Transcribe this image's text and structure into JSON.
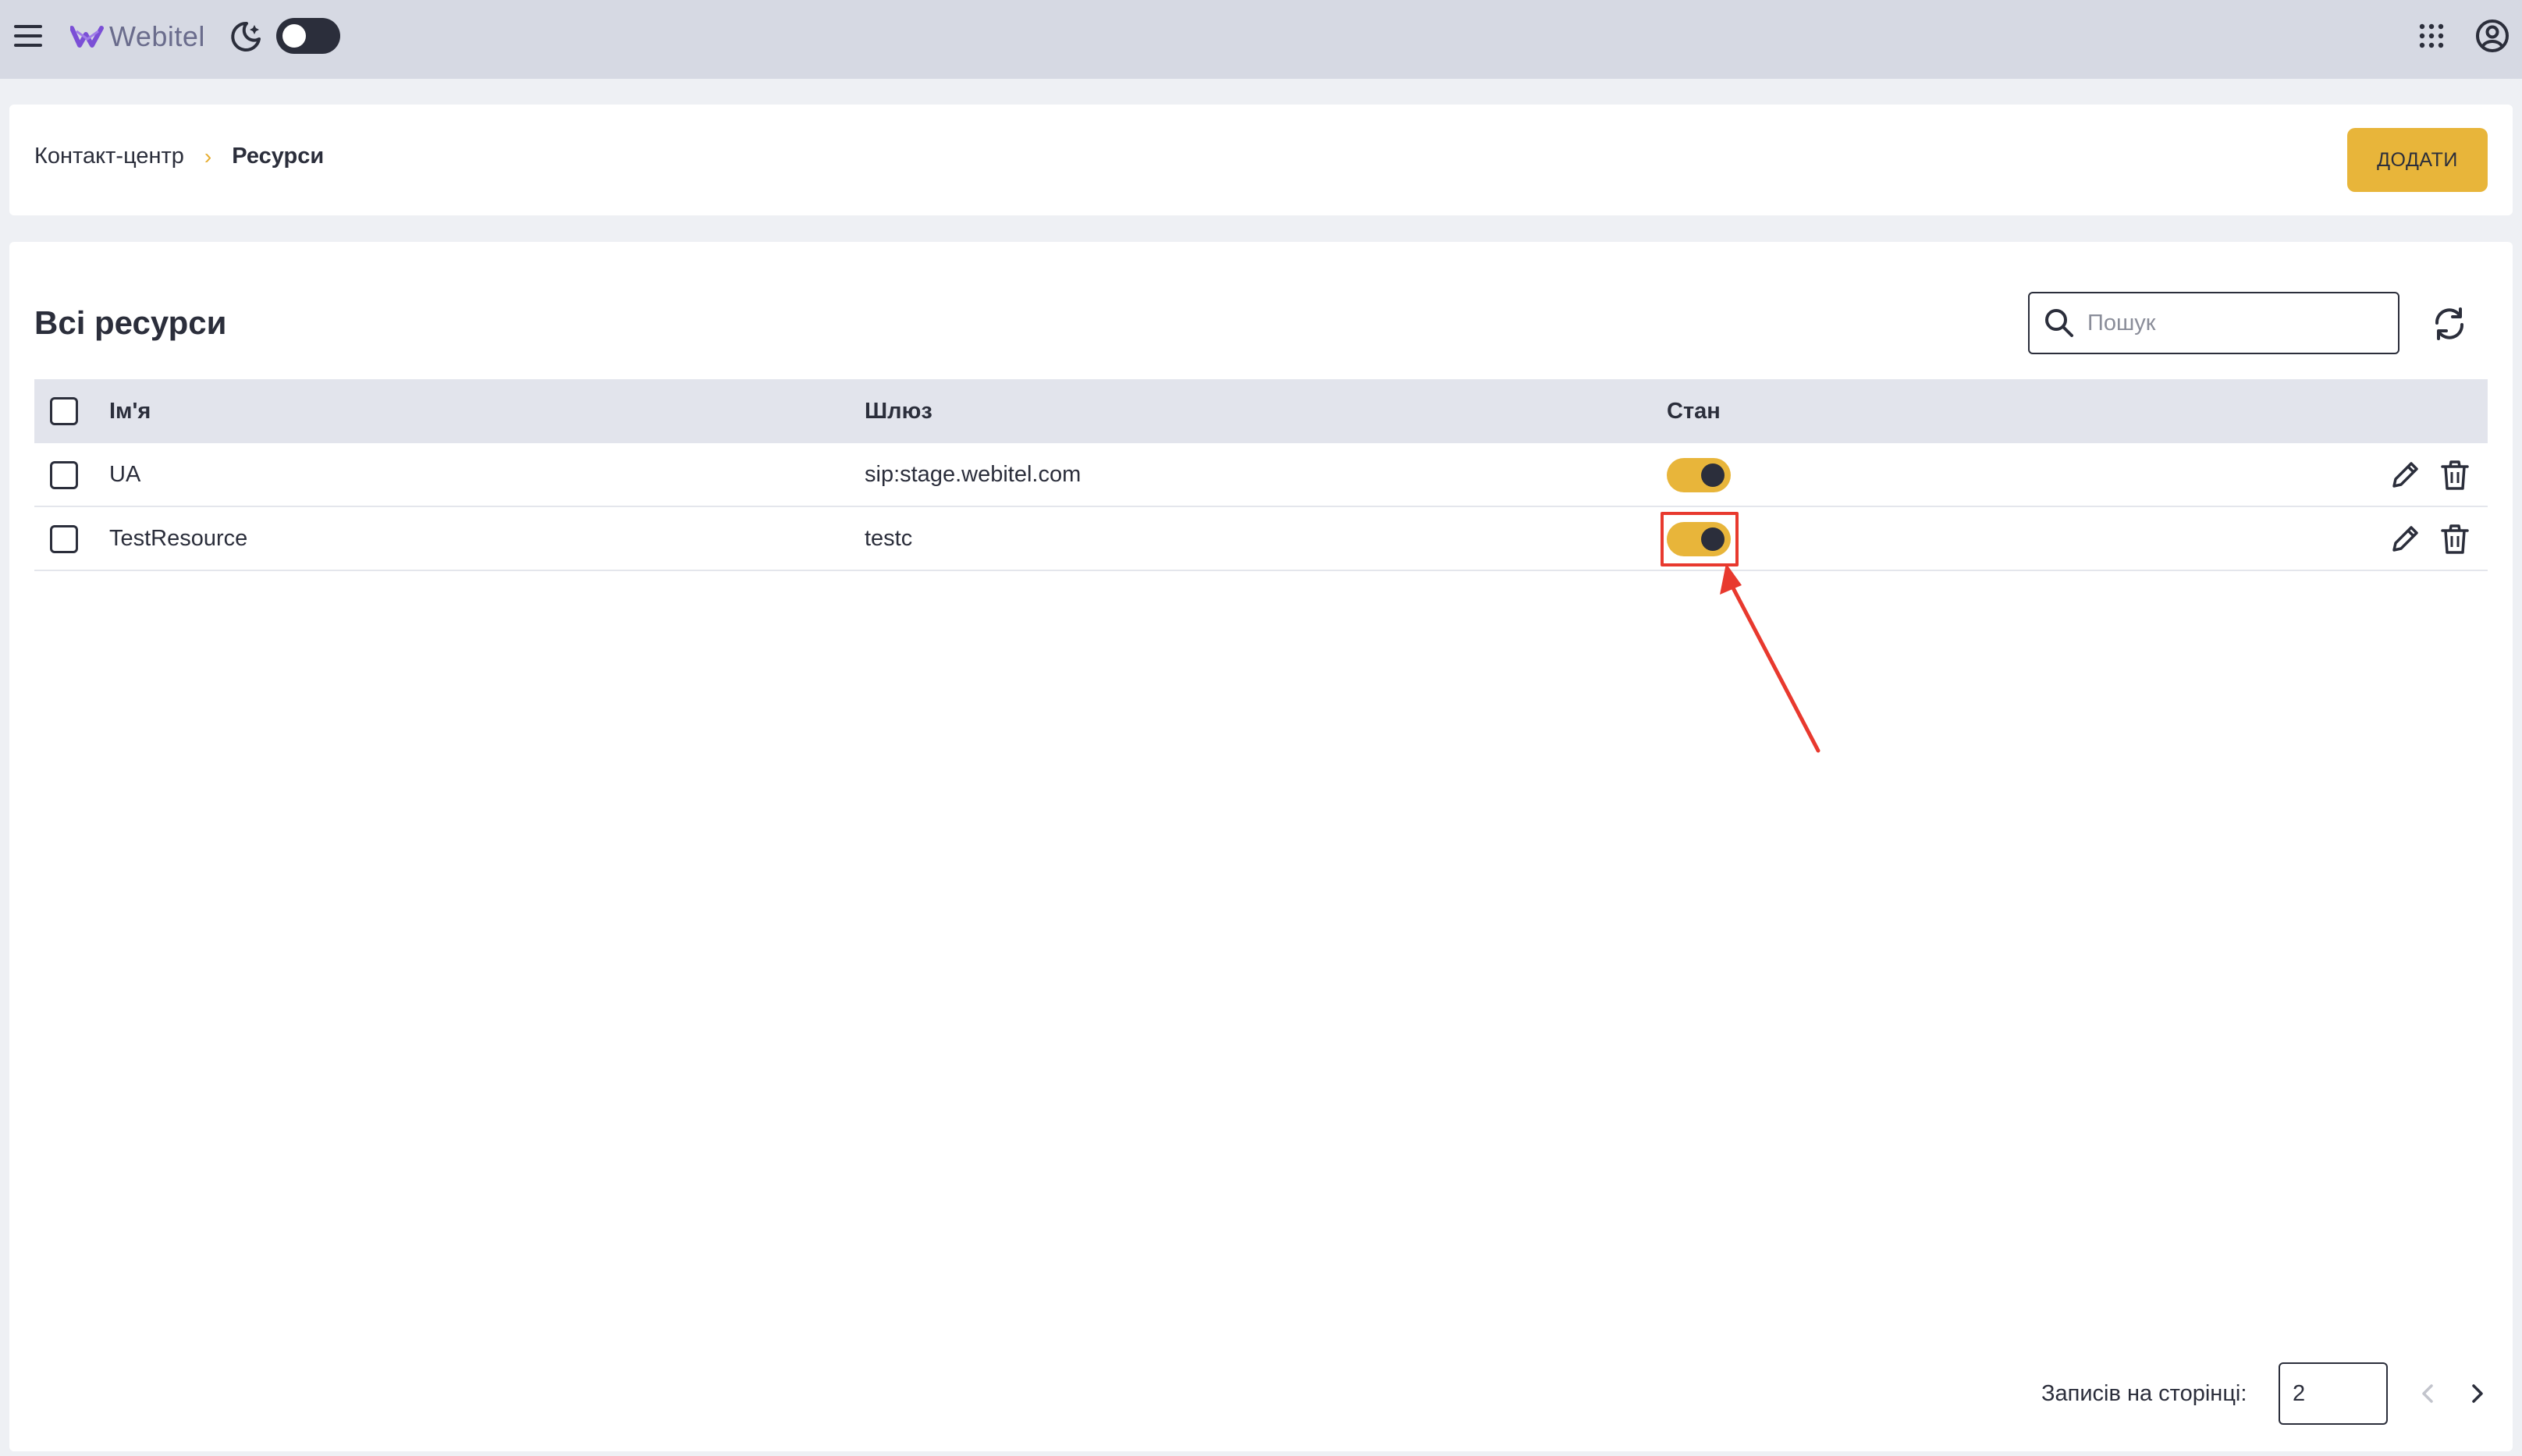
{
  "topbar": {
    "logo_text": "Webitel",
    "icons": [
      "menu-icon",
      "webitel-logo",
      "dark-mode-icon",
      "apps-grid-icon",
      "account-icon"
    ],
    "theme_toggle_on": false
  },
  "breadcrumb": {
    "parent": "Контакт-центр",
    "current": "Ресурси"
  },
  "actions": {
    "add_label": "ДОДАТИ"
  },
  "main": {
    "title": "Всі ресурси",
    "search": {
      "placeholder": "Пошук",
      "value": ""
    }
  },
  "table": {
    "columns": [
      "Ім'я",
      "Шлюз",
      "Стан"
    ],
    "rows": [
      {
        "name": "UA",
        "gateway": "sip:stage.webitel.com",
        "state_enabled": true
      },
      {
        "name": "TestResource",
        "gateway": "testc",
        "state_enabled": true
      }
    ]
  },
  "pagination": {
    "per_page_label": "Записів на сторінці:",
    "per_page_value": "2"
  },
  "colors": {
    "topbar_bg": "#d6d9e3",
    "accent": "#e8b53a",
    "text": "#2b2e3b",
    "annotation": "#e8392e"
  }
}
